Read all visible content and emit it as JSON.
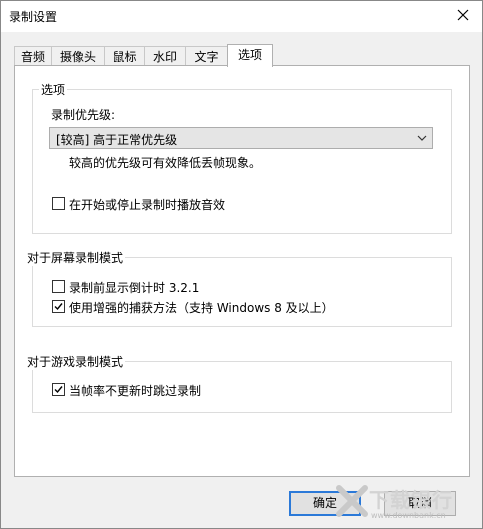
{
  "window": {
    "title": "录制设置"
  },
  "tabs": [
    {
      "label": "音频"
    },
    {
      "label": "摄像头"
    },
    {
      "label": "鼠标"
    },
    {
      "label": "水印"
    },
    {
      "label": "文字"
    },
    {
      "label": "选项",
      "active": true
    }
  ],
  "options": {
    "group_label": "选项",
    "priority_label": "录制优先级:",
    "priority_value": "[较高] 高于正常优先级",
    "priority_hint": "较高的优先级可有效降低丢帧现象。",
    "sound_checkbox": {
      "label": "在开始或停止录制时播放音效",
      "checked": false
    }
  },
  "screen_mode": {
    "group_label": "对于屏幕录制模式",
    "countdown_checkbox": {
      "label": "录制前显示倒计时 3.2.1",
      "checked": false
    },
    "enhanced_checkbox": {
      "label": "使用增强的捕获方法（支持 Windows 8 及以上）",
      "checked": true
    }
  },
  "game_mode": {
    "group_label": "对于游戏录制模式",
    "skip_checkbox": {
      "label": "当帧率不更新时跳过录制",
      "checked": true
    }
  },
  "buttons": {
    "ok": "确定",
    "cancel": "取消"
  },
  "watermark": {
    "text": "下载银行",
    "url": "www.downbank.cn"
  }
}
